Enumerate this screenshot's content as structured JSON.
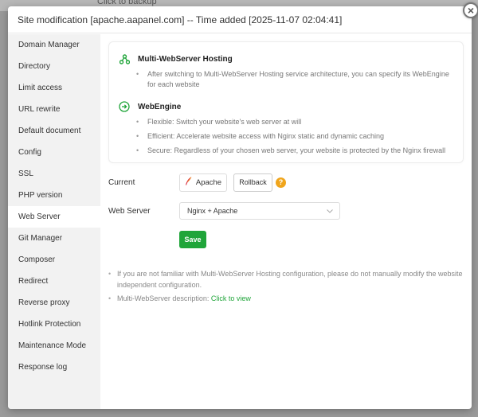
{
  "backdrop": {
    "text": "Click to backup"
  },
  "dialog": {
    "title": "Site modification [apache.aapanel.com] -- Time added [2025-11-07 02:04:41]",
    "close_glyph": "×"
  },
  "sidebar": {
    "items": [
      {
        "label": "Domain Manager"
      },
      {
        "label": "Directory"
      },
      {
        "label": "Limit access"
      },
      {
        "label": "URL rewrite"
      },
      {
        "label": "Default document"
      },
      {
        "label": "Config"
      },
      {
        "label": "SSL"
      },
      {
        "label": "PHP version"
      },
      {
        "label": "Web Server"
      },
      {
        "label": "Git Manager"
      },
      {
        "label": "Composer"
      },
      {
        "label": "Redirect"
      },
      {
        "label": "Reverse proxy"
      },
      {
        "label": "Hotlink Protection"
      },
      {
        "label": "Maintenance Mode"
      },
      {
        "label": "Response log"
      }
    ],
    "active": "Web Server"
  },
  "info": {
    "hosting_title": "Multi-WebServer Hosting",
    "hosting_bullets": [
      "After switching to Multi-WebServer Hosting service architecture, you can specify its WebEngine for each website"
    ],
    "engine_title": "WebEngine",
    "engine_bullets": [
      "Flexible: Switch your website's web server at will",
      "Efficient: Accelerate website access with Nginx static and dynamic caching",
      "Secure: Regardless of your chosen web server, your website is protected by the Nginx firewall"
    ]
  },
  "form": {
    "current_label": "Current",
    "current_value": "Apache",
    "rollback_label": "Rollback",
    "help_glyph": "?",
    "webserver_label": "Web Server",
    "webserver_value": "Nginx + Apache",
    "save_label": "Save"
  },
  "notes": {
    "note1": "If you are not familiar with Multi-WebServer Hosting configuration, please do not manually modify the website independent configuration.",
    "note2_prefix": "Multi-WebServer description:",
    "note2_link": "Click to view"
  },
  "colors": {
    "accent_green": "#20a53a",
    "help_orange": "#f0a51c",
    "sidebar_bg": "#f2f2f2"
  },
  "icons": {
    "hosting": "network-nodes-icon",
    "engine": "arrow-circle-icon",
    "current": "apache-feather-icon",
    "select": "chevron-down-icon",
    "close": "close-icon",
    "help": "question-icon"
  }
}
